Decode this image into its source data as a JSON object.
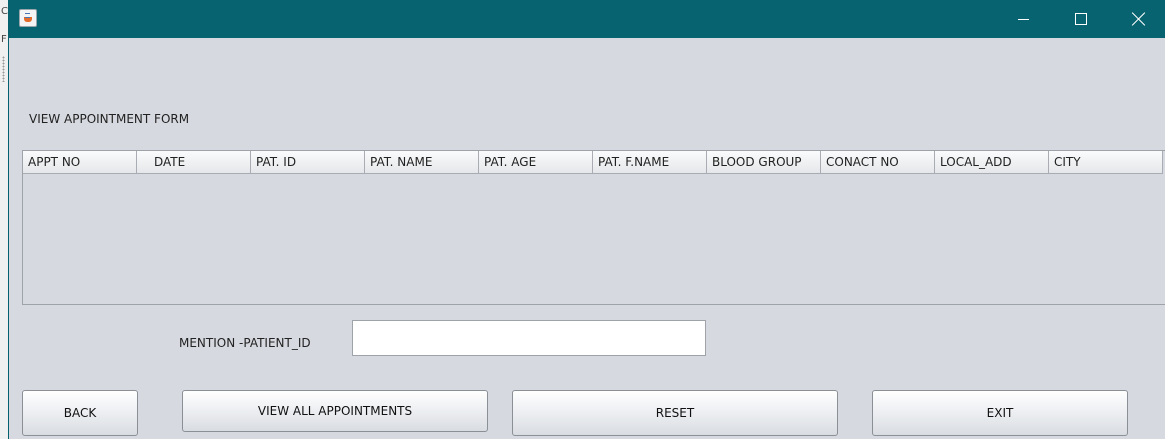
{
  "window": {
    "title": ""
  },
  "form": {
    "title": "VIEW APPOINTMENT FORM"
  },
  "table": {
    "columns": [
      "APPT NO",
      "DATE",
      "PAT. ID",
      "PAT. NAME",
      "PAT. AGE",
      "PAT. F.NAME",
      "BLOOD GROUP",
      "CONACT NO",
      "LOCAL_ADD",
      "CITY"
    ],
    "rows": []
  },
  "search": {
    "label": "MENTION -PATIENT_ID",
    "value": "",
    "placeholder": ""
  },
  "buttons": {
    "back": "BACK",
    "view_all": "VIEW ALL APPOINTMENTS",
    "reset": "RESET",
    "exit": "EXIT"
  },
  "colors": {
    "titlebar": "#07636f",
    "background": "#d6d9df"
  },
  "icons": {
    "app": "java-cup-icon",
    "minimize": "minimize-icon",
    "maximize": "maximize-icon",
    "close": "close-icon"
  }
}
